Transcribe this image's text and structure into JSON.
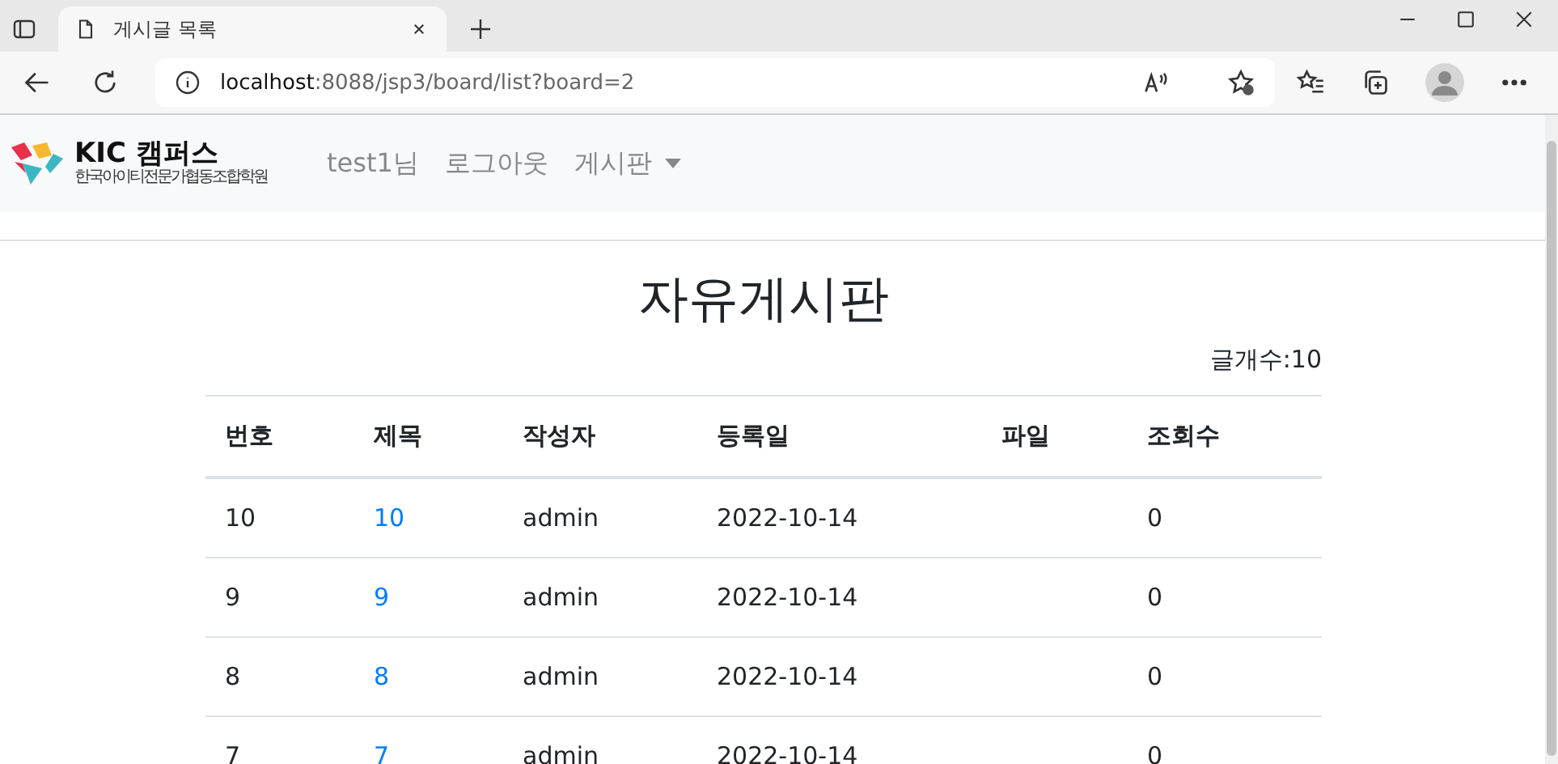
{
  "browser": {
    "tab": {
      "title": "게시글 목록",
      "selected": true
    },
    "address": {
      "host": "localhost",
      "path": ":8088/jsp3/board/list?board=2"
    }
  },
  "navbar": {
    "logo": {
      "name": "KIC 캠퍼스",
      "subtitle": "한국아이티전문가협동조합학원"
    },
    "links": [
      {
        "label": "test1님",
        "kind": "text"
      },
      {
        "label": "로그아웃",
        "kind": "link"
      },
      {
        "label": "게시판",
        "kind": "dropdown"
      }
    ]
  },
  "board": {
    "title": "자유게시판",
    "count": "글개수:10",
    "columns": [
      "번호",
      "제목",
      "작성자",
      "등록일",
      "파일",
      "조회수"
    ],
    "rows": [
      {
        "number": "10",
        "title": "10",
        "author": "admin",
        "date": "2022-10-14",
        "views": "0"
      },
      {
        "number": "9",
        "title": "9",
        "author": "admin",
        "date": "2022-10-14",
        "views": "0"
      },
      {
        "number": "8",
        "title": "8",
        "author": "admin",
        "date": "2022-10-14",
        "views": "0"
      },
      {
        "number": "7",
        "title": "7",
        "author": "admin",
        "date": "2022-10-14",
        "views": "0"
      }
    ]
  }
}
